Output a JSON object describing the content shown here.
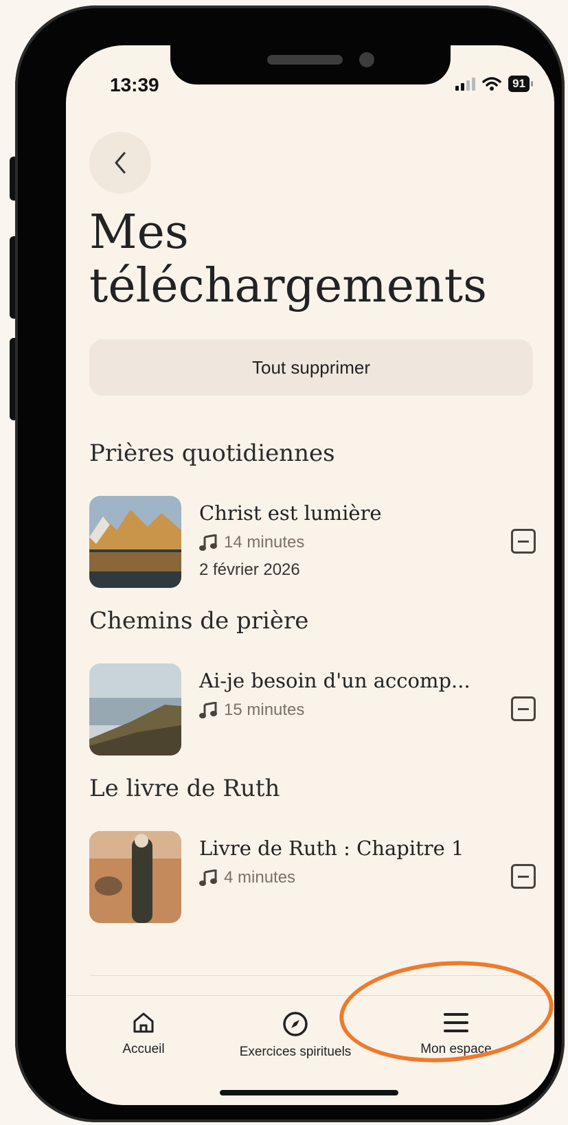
{
  "status_bar": {
    "time": "13:39",
    "battery": "91"
  },
  "page": {
    "title_line1": "Mes",
    "title_line2": "téléchargements",
    "delete_all": "Tout supprimer"
  },
  "sections": [
    {
      "title": "Prières quotidiennes",
      "item": {
        "title": "Christ est lumière",
        "duration": "14 minutes",
        "date": "2 février 2026"
      }
    },
    {
      "title": "Chemins de prière",
      "item": {
        "title": "Ai-je besoin d'un accomp...",
        "duration": "15 minutes"
      }
    },
    {
      "title": "Le livre de Ruth",
      "item": {
        "title": "Livre de Ruth : Chapitre 1",
        "duration": "4 minutes"
      }
    }
  ],
  "tabs": [
    {
      "label": "Accueil",
      "icon": "home-icon"
    },
    {
      "label": "Exercices spirituels",
      "icon": "compass-icon"
    },
    {
      "label": "Mon espace",
      "icon": "menu-icon",
      "highlighted": true
    }
  ],
  "colors": {
    "background": "#f9f3ea",
    "highlight_ring": "#ef7a2b",
    "button_bg": "#efe6de"
  }
}
